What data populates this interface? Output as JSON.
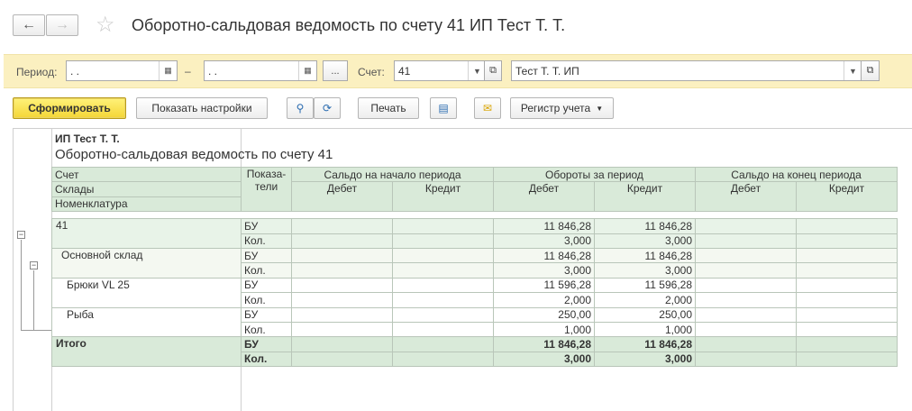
{
  "window": {
    "title": "Оборотно-сальдовая ведомость по счету 41 ИП Тест Т. Т."
  },
  "params": {
    "period_label": "Период:",
    "period_from": " .  .",
    "dash": "–",
    "period_to": " .  .",
    "more_label": "...",
    "account_label": "Счет:",
    "account_value": "41",
    "org_value": "Тест Т. Т. ИП"
  },
  "toolbar": {
    "generate_label": "Сформировать",
    "settings_label": "Показать настройки",
    "print_label": "Печать",
    "register_label": "Регистр учета"
  },
  "report": {
    "org": "ИП Тест Т. Т.",
    "title": "Оборотно-сальдовая ведомость по счету 41",
    "group_headers": [
      "Счет",
      "Склады",
      "Номенклатура"
    ],
    "indicator_header": "Показа-\nтели",
    "col_groups": [
      "Сальдо на начало периода",
      "Обороты за период",
      "Сальдо на конец периода"
    ],
    "sub_cols": [
      "Дебет",
      "Кредит",
      "Дебет",
      "Кредит",
      "Дебет",
      "Кредит"
    ],
    "rows": [
      {
        "name": "41",
        "ind": [
          "БУ",
          "Кол."
        ],
        "turn_debit": [
          "11 846,28",
          "3,000"
        ],
        "turn_credit": [
          "11 846,28",
          "3,000"
        ]
      },
      {
        "name": "Основной склад",
        "ind": [
          "БУ",
          "Кол."
        ],
        "turn_debit": [
          "11 846,28",
          "3,000"
        ],
        "turn_credit": [
          "11 846,28",
          "3,000"
        ]
      },
      {
        "name": "Брюки VL 25",
        "ind": [
          "БУ",
          "Кол."
        ],
        "turn_debit": [
          "11 596,28",
          "2,000"
        ],
        "turn_credit": [
          "11 596,28",
          "2,000"
        ]
      },
      {
        "name": "Рыба",
        "ind": [
          "БУ",
          "Кол."
        ],
        "turn_debit": [
          "250,00",
          "1,000"
        ],
        "turn_credit": [
          "250,00",
          "1,000"
        ]
      }
    ],
    "total": {
      "name": "Итого",
      "ind": [
        "БУ",
        "Кол."
      ],
      "turn_debit": [
        "11 846,28",
        "3,000"
      ],
      "turn_credit": [
        "11 846,28",
        "3,000"
      ]
    }
  },
  "icons": {
    "back": "arrow-left-icon",
    "forward": "arrow-right-icon",
    "favorite": "star-icon",
    "calendar": "calendar-icon",
    "dropdown": "chevron-down-icon",
    "open": "open-form-icon",
    "find": "search-icon",
    "find_cancel": "search-cancel-icon",
    "preview": "print-preview-icon",
    "mail": "envelope-icon",
    "collapse": "collapse-icon"
  },
  "colors": {
    "params_bg": "#fbf0c0",
    "primary_btn": "#f4d536",
    "header_green": "#d9ead9",
    "group_green": "#e8f3e8"
  }
}
